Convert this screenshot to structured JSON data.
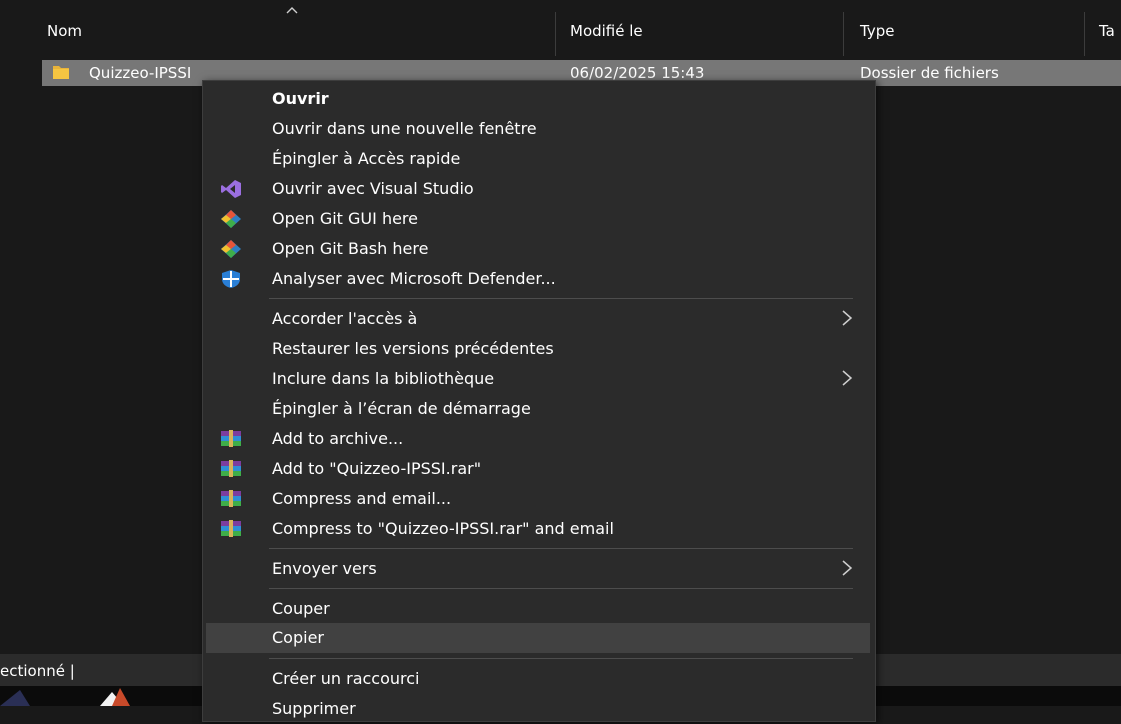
{
  "columns": {
    "name": "Nom",
    "modified": "Modifié le",
    "type": "Type",
    "size_truncated": "Ta"
  },
  "file_row": {
    "name": "Quizzeo-IPSSI",
    "modified": "06/02/2025 15:43",
    "type": "Dossier de fichiers"
  },
  "status": {
    "selected_text": "ectionné  |"
  },
  "context_menu": {
    "items": [
      {
        "label": "Ouvrir",
        "icon": ""
      },
      {
        "label": "Ouvrir dans une nouvelle fenêtre",
        "icon": ""
      },
      {
        "label": "Épingler à Accès rapide",
        "icon": ""
      },
      {
        "label": "Ouvrir avec Visual Studio",
        "icon": "visual-studio-icon"
      },
      {
        "label": "Open Git GUI here",
        "icon": "git-icon"
      },
      {
        "label": "Open Git Bash here",
        "icon": "git-icon"
      },
      {
        "label": "Analyser avec Microsoft Defender...",
        "icon": "defender-shield-icon"
      },
      {
        "label": "Accorder l'accès à",
        "icon": "",
        "submenu": true
      },
      {
        "label": "Restaurer les versions précédentes",
        "icon": ""
      },
      {
        "label": "Inclure dans la bibliothèque",
        "icon": "",
        "submenu": true
      },
      {
        "label": "Épingler à l’écran de démarrage",
        "icon": ""
      },
      {
        "label": "Add to archive...",
        "icon": "winrar-icon"
      },
      {
        "label": "Add to \"Quizzeo-IPSSI.rar\"",
        "icon": "winrar-icon"
      },
      {
        "label": "Compress and email...",
        "icon": "winrar-icon"
      },
      {
        "label": "Compress to \"Quizzeo-IPSSI.rar\" and email",
        "icon": "winrar-icon"
      },
      {
        "label": "Envoyer vers",
        "icon": "",
        "submenu": true
      },
      {
        "label": "Couper",
        "icon": ""
      },
      {
        "label": "Copier",
        "icon": "",
        "hovered": true
      },
      {
        "label": "Créer un raccourci",
        "icon": ""
      },
      {
        "label": "Supprimer",
        "icon": ""
      }
    ]
  },
  "colors": {
    "background": "#191919",
    "menu_background": "#2b2b2b",
    "selected_row": "#777777",
    "hover_item": "#414141",
    "folder": "#f5c542"
  }
}
